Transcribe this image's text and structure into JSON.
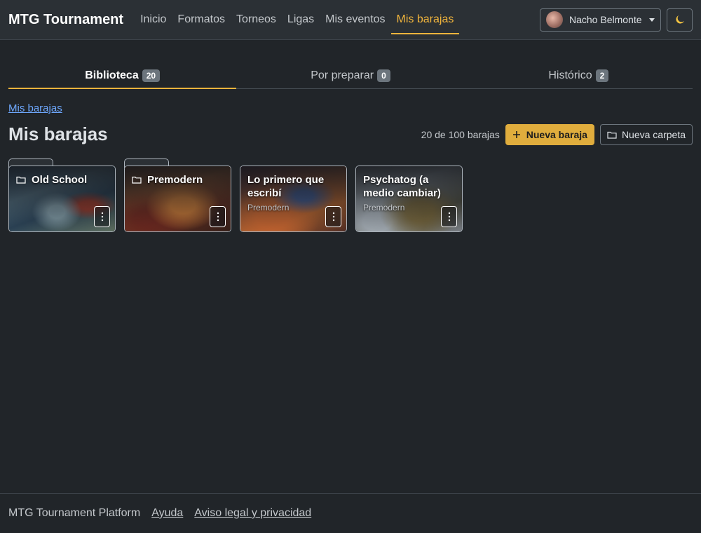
{
  "navbar": {
    "brand": "MTG Tournament",
    "links": [
      {
        "label": "Inicio"
      },
      {
        "label": "Formatos"
      },
      {
        "label": "Torneos"
      },
      {
        "label": "Ligas"
      },
      {
        "label": "Mis eventos"
      },
      {
        "label": "Mis barajas",
        "active": true
      }
    ],
    "user_name": "Nacho Belmonte"
  },
  "tabs": [
    {
      "label": "Biblioteca",
      "count": "20",
      "active": true
    },
    {
      "label": "Por preparar",
      "count": "0"
    },
    {
      "label": "Histórico",
      "count": "2"
    }
  ],
  "breadcrumb": "Mis barajas",
  "page_title": "Mis barajas",
  "header": {
    "count_text": "20 de 100 barajas",
    "new_deck_label": "Nueva baraja",
    "new_folder_label": "Nueva carpeta"
  },
  "cards": [
    {
      "title": "Old School",
      "type": "folder",
      "subtitle": ""
    },
    {
      "title": "Premodern",
      "type": "folder",
      "subtitle": ""
    },
    {
      "title": "Lo primero que escribí",
      "type": "deck",
      "subtitle": "Premodern"
    },
    {
      "title": "Psychatog (a medio cambiar)",
      "type": "deck",
      "subtitle": "Premodern"
    }
  ],
  "footer": {
    "platform": "MTG Tournament Platform",
    "help": "Ayuda",
    "legal": "Aviso legal y privacidad"
  },
  "colors": {
    "accent": "#f0b43c",
    "background": "#212529",
    "navbar": "#2b3035",
    "link": "#6ea8fe"
  },
  "icons": {
    "theme": "moon-icon",
    "folder": "folder-icon",
    "plus": "plus-icon",
    "menu": "kebab-menu-icon"
  }
}
